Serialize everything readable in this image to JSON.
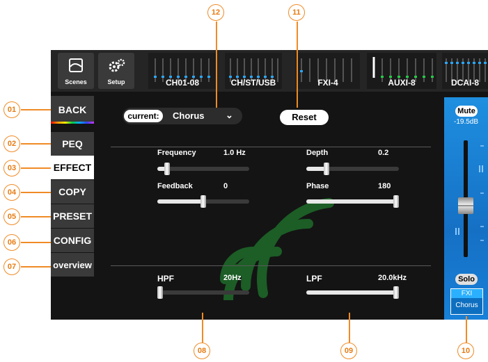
{
  "topbar": {
    "scenes_label": "Scenes",
    "setup_label": "Setup",
    "banks": [
      {
        "label": "CH01-08"
      },
      {
        "label": "CH/ST/USB"
      },
      {
        "label": "FXI-4"
      },
      {
        "label": "AUXI-8"
      },
      {
        "label": "DCAI-8"
      }
    ]
  },
  "nav": {
    "items": [
      {
        "label": "BACK"
      },
      {
        "label": "PEQ"
      },
      {
        "label": "EFFECT"
      },
      {
        "label": "COPY"
      },
      {
        "label": "PRESET"
      },
      {
        "label": "CONFIG"
      },
      {
        "label": "overview"
      }
    ],
    "active": "EFFECT"
  },
  "effect": {
    "current_label": "current:",
    "current_value": "Chorus",
    "reset_label": "Reset",
    "params": [
      {
        "label": "Frequency",
        "value": "1.0 Hz",
        "level": 0.08
      },
      {
        "label": "Depth",
        "value": "0.2",
        "level": 0.2
      },
      {
        "label": "Feedback",
        "value": "0",
        "level": 0.5
      },
      {
        "label": "Phase",
        "value": "180",
        "level": 1.0
      }
    ],
    "filters": [
      {
        "label": "HPF",
        "value": "20Hz",
        "level": 0.0
      },
      {
        "label": "LPF",
        "value": "20.0kHz",
        "level": 1.0
      }
    ]
  },
  "fader": {
    "mute_label": "Mute",
    "level_db": "-19.5dB",
    "solo_label": "Solo",
    "channel_top": "FXI",
    "channel_bottom": "Chorus",
    "fader_position": 0.5
  },
  "callouts": [
    "01",
    "02",
    "03",
    "04",
    "05",
    "06",
    "07",
    "08",
    "09",
    "10",
    "11",
    "12"
  ],
  "colors": {
    "callout": "#f08a24",
    "fader_bg": "#1b7fd6",
    "meter_blue": "#2aa7ff",
    "meter_green": "#22cc44",
    "watermark": "#1c5e26"
  }
}
